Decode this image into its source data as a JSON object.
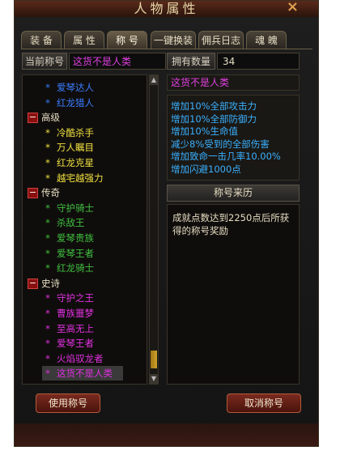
{
  "window": {
    "title": "人物属性",
    "close_icon": "×"
  },
  "tabs": [
    {
      "label": "装 备"
    },
    {
      "label": "属 性"
    },
    {
      "label": "称 号"
    },
    {
      "label": "一键换装"
    },
    {
      "label": "佣兵日志"
    },
    {
      "label": "魂 魄"
    }
  ],
  "current_title": {
    "label": "当前称号",
    "value": "这货不是人类"
  },
  "owned": {
    "label": "拥有数量",
    "value": "34"
  },
  "list_items": [
    {
      "kind": "item",
      "text": "爱琴达人",
      "color": "#3a7cff"
    },
    {
      "kind": "item",
      "text": "红龙猎人",
      "color": "#3a7cff"
    },
    {
      "kind": "group",
      "text": "高级",
      "toggle": "−"
    },
    {
      "kind": "item",
      "text": "冷酷杀手",
      "color": "#f0e040"
    },
    {
      "kind": "item",
      "text": "万人瞩目",
      "color": "#f0e040"
    },
    {
      "kind": "item",
      "text": "红龙克星",
      "color": "#f0e040"
    },
    {
      "kind": "item",
      "text": "越宅越强力",
      "color": "#f0e040"
    },
    {
      "kind": "group",
      "text": "传奇",
      "toggle": "−"
    },
    {
      "kind": "item",
      "text": "守护骑士",
      "color": "#40c040"
    },
    {
      "kind": "item",
      "text": "杀敌王",
      "color": "#40c040"
    },
    {
      "kind": "item",
      "text": "爱琴贵族",
      "color": "#40c040"
    },
    {
      "kind": "item",
      "text": "爱琴王者",
      "color": "#40c040"
    },
    {
      "kind": "item",
      "text": "红龙骑士",
      "color": "#40c040"
    },
    {
      "kind": "group",
      "text": "史诗",
      "toggle": "−"
    },
    {
      "kind": "item",
      "text": "守护之王",
      "color": "#e030e0"
    },
    {
      "kind": "item",
      "text": "曹族噩梦",
      "color": "#e030e0"
    },
    {
      "kind": "item",
      "text": "至高无上",
      "color": "#e030e0"
    },
    {
      "kind": "item",
      "text": "爱琴王者",
      "color": "#e030e0"
    },
    {
      "kind": "item",
      "text": "火焰驭龙者",
      "color": "#e030e0"
    },
    {
      "kind": "item",
      "text": "这货不是人类",
      "color": "#e030e0",
      "selected": true
    }
  ],
  "star_glyph": "*",
  "scroll": {
    "up": "▲",
    "down": "▼"
  },
  "selected_title": "这货不是人类",
  "attributes": [
    "增加10%全部攻击力",
    "增加10%全部防御力",
    "增加10%生命值",
    "减少8%受到的全部伤害",
    "增加致命一击几率10.00%",
    "增加闪避1000点"
  ],
  "source": {
    "header": "称号来历",
    "text": "成就点数达到2250点后所获得的称号奖励"
  },
  "buttons": {
    "use": "使用称号",
    "cancel": "取消称号"
  }
}
